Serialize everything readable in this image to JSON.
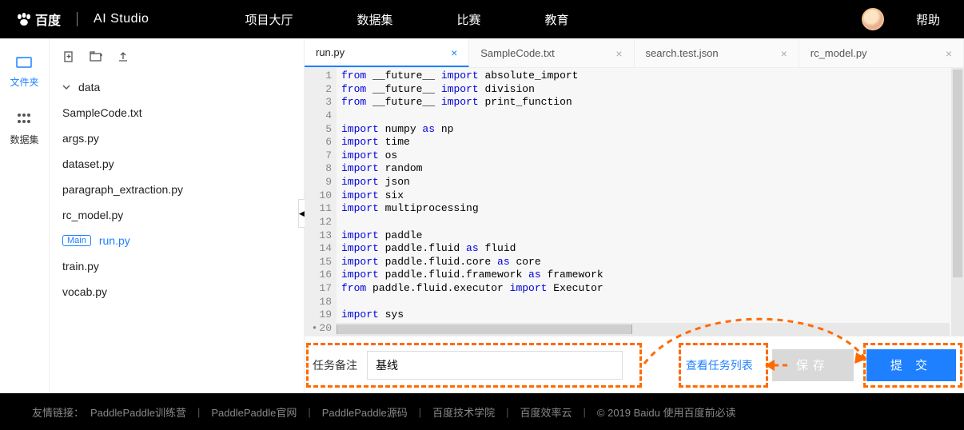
{
  "nav": {
    "logo_text": "百度",
    "studio_text": "AI Studio",
    "items": [
      "项目大厅",
      "数据集",
      "比赛",
      "教育"
    ],
    "help": "帮助"
  },
  "rail": {
    "files": "文件夹",
    "datasets": "数据集"
  },
  "files": {
    "folder": "data",
    "list": [
      "SampleCode.txt",
      "args.py",
      "dataset.py",
      "paragraph_extraction.py",
      "rc_model.py"
    ],
    "main_badge": "Main",
    "main_file": "run.py",
    "tail": [
      "train.py",
      "vocab.py"
    ]
  },
  "tabs": [
    {
      "label": "run.py",
      "active": true
    },
    {
      "label": "SampleCode.txt",
      "active": false
    },
    {
      "label": "search.test.json",
      "active": false
    },
    {
      "label": "rc_model.py",
      "active": false
    }
  ],
  "code": {
    "lines": 24,
    "marked_line": 20
  },
  "bottom": {
    "remark_label": "任务备注",
    "remark_value": "基线",
    "view_tasks": "查看任务列表",
    "save": "保存",
    "submit": "提 交"
  },
  "footer": {
    "prefix": "友情链接：",
    "links": [
      "PaddlePaddle训练营",
      "PaddlePaddle官网",
      "PaddlePaddle源码",
      "百度技术学院",
      "百度效率云"
    ],
    "copyright": "© 2019 Baidu 使用百度前必读"
  }
}
